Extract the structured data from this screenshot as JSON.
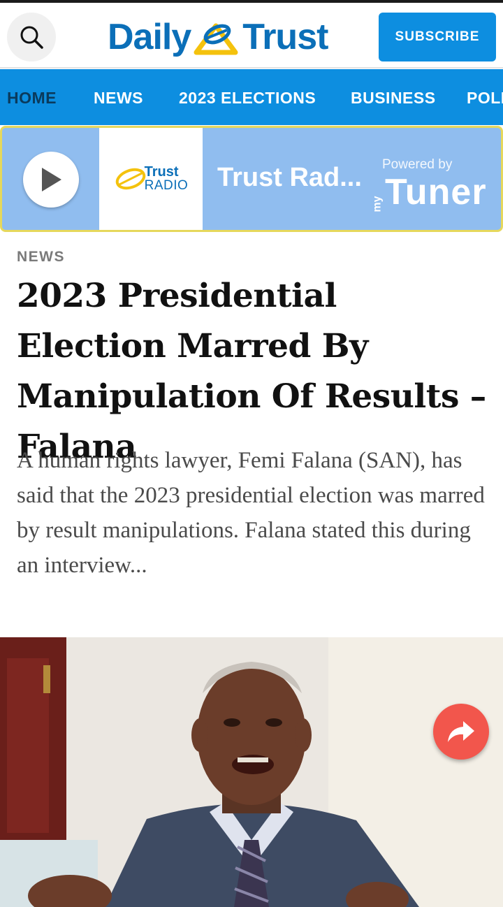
{
  "header": {
    "logo_left": "Daily",
    "logo_right": "Trust",
    "subscribe_label": "SUBSCRIBE"
  },
  "nav": {
    "items": [
      {
        "label": "HOME",
        "active": true
      },
      {
        "label": "NEWS",
        "active": false
      },
      {
        "label": "2023 ELECTIONS",
        "active": false
      },
      {
        "label": "BUSINESS",
        "active": false
      },
      {
        "label": "POLI",
        "active": false
      }
    ]
  },
  "radio": {
    "station_logo_line1": "Trust",
    "station_logo_line2": "RADIO",
    "title": "Trust Rad...",
    "powered_by": "Powered by",
    "provider_prefix": "my",
    "provider": "Tuner"
  },
  "article": {
    "category": "NEWS",
    "headline": "2023 Presidential Election Marred By Manipulation Of Results – Falana",
    "excerpt": "A human rights lawyer, Femi Falana (SAN), has said that the 2023 presidential election was marred by result manipulations.  Falana stated this during an interview..."
  },
  "icons": {
    "search": "search-icon",
    "play": "play-icon",
    "share": "share-icon"
  },
  "colors": {
    "brand_blue": "#0d8ee0",
    "logo_blue": "#0b6fb8",
    "logo_yellow": "#f4c20d",
    "radio_bg": "#90bdef",
    "share_red": "#f2564c"
  }
}
